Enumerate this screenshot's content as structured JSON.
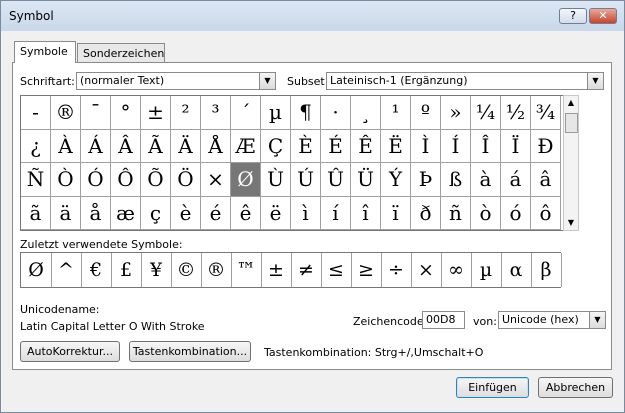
{
  "window": {
    "title": "Symbol",
    "help_label": "?",
    "close_label": "✕"
  },
  "tabs": [
    {
      "label": "Symbole"
    },
    {
      "label": "Sonderzeichen"
    }
  ],
  "font": {
    "label": "Schriftart:",
    "value": "(normaler Text)"
  },
  "subset": {
    "label": "Subset:",
    "value": "Lateinisch-1 (Ergänzung)"
  },
  "symbol_grid": {
    "rows": [
      [
        "-",
        "®",
        "¯",
        "°",
        "±",
        "²",
        "³",
        "´",
        "µ",
        "¶",
        "·",
        "¸",
        "¹",
        "º",
        "»",
        "¼",
        "½",
        "¾"
      ],
      [
        "¿",
        "À",
        "Á",
        "Â",
        "Ã",
        "Ä",
        "Å",
        "Æ",
        "Ç",
        "È",
        "É",
        "Ê",
        "Ë",
        "Ì",
        "Í",
        "Î",
        "Ï",
        "Đ"
      ],
      [
        "Ñ",
        "Ò",
        "Ó",
        "Ô",
        "Õ",
        "Ö",
        "×",
        "Ø",
        "Ù",
        "Ú",
        "Û",
        "Ü",
        "Ý",
        "Þ",
        "ß",
        "à",
        "á",
        "â"
      ],
      [
        "ã",
        "ä",
        "å",
        "æ",
        "ç",
        "è",
        "é",
        "ê",
        "ë",
        "ì",
        "í",
        "î",
        "ï",
        "ð",
        "ñ",
        "ò",
        "ó",
        "ô"
      ]
    ],
    "selected": "Ø"
  },
  "recent": {
    "label": "Zuletzt verwendete Symbole:",
    "symbols": [
      "Ø",
      "^",
      "€",
      "£",
      "¥",
      "©",
      "®",
      "™",
      "±",
      "≠",
      "≤",
      "≥",
      "÷",
      "×",
      "∞",
      "µ",
      "α",
      "β"
    ]
  },
  "unicode_name": {
    "label": "Unicodename:",
    "value": "Latin Capital Letter O With Stroke"
  },
  "char_code": {
    "label": "Zeichencode:",
    "value": "00D8"
  },
  "from": {
    "label": "von:",
    "value": "Unicode (hex)"
  },
  "buttons": {
    "autocorrect": "AutoKorrektur...",
    "shortcut_key": "Tastenkombination...",
    "insert": "Einfügen",
    "cancel": "Abbrechen"
  },
  "shortcut_text": "Tastenkombination: Strg+/,Umschalt+O"
}
